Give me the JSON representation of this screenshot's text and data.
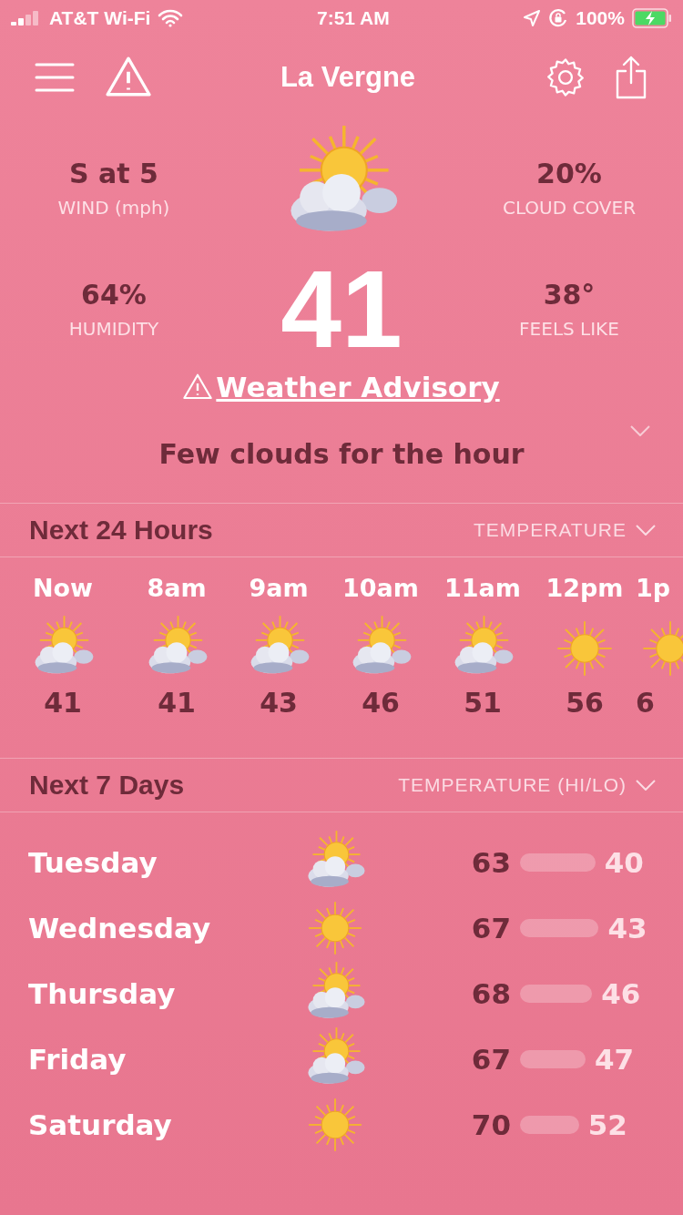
{
  "status_bar": {
    "carrier": "AT&T Wi-Fi",
    "time": "7:51 AM",
    "battery": "100%"
  },
  "header": {
    "title": "La Vergne"
  },
  "current": {
    "kind": "partly-cloudy",
    "temperature": "41",
    "stats": [
      {
        "value": "S at 5",
        "label": "WIND (mph)"
      },
      {
        "value": "20%",
        "label": "CLOUD COVER"
      },
      {
        "value": "64%",
        "label": "HUMIDITY"
      },
      {
        "value": "38°",
        "label": "FEELS LIKE"
      }
    ],
    "advisory": "Weather Advisory",
    "summary": "Few clouds for the hour"
  },
  "hourly": {
    "title": "Next 24 Hours",
    "selector": "TEMPERATURE",
    "items": [
      {
        "time": "Now",
        "kind": "partly-cloudy",
        "temp": "41"
      },
      {
        "time": "8am",
        "kind": "partly-cloudy",
        "temp": "41"
      },
      {
        "time": "9am",
        "kind": "partly-cloudy",
        "temp": "43"
      },
      {
        "time": "10am",
        "kind": "partly-cloudy",
        "temp": "46"
      },
      {
        "time": "11am",
        "kind": "partly-cloudy",
        "temp": "51"
      },
      {
        "time": "12pm",
        "kind": "sunny",
        "temp": "56"
      },
      {
        "time": "1p",
        "kind": "sunny",
        "temp": "6"
      }
    ]
  },
  "daily": {
    "title": "Next 7 Days",
    "selector": "TEMPERATURE (HI/LO)",
    "days": [
      {
        "day": "Tuesday",
        "kind": "partly-cloudy",
        "high": "63",
        "low": "40"
      },
      {
        "day": "Wednesday",
        "kind": "sunny",
        "high": "67",
        "low": "43"
      },
      {
        "day": "Thursday",
        "kind": "partly-cloudy",
        "high": "68",
        "low": "46"
      },
      {
        "day": "Friday",
        "kind": "partly-cloudy",
        "high": "67",
        "low": "47"
      },
      {
        "day": "Saturday",
        "kind": "sunny",
        "high": "70",
        "low": "52"
      }
    ]
  }
}
